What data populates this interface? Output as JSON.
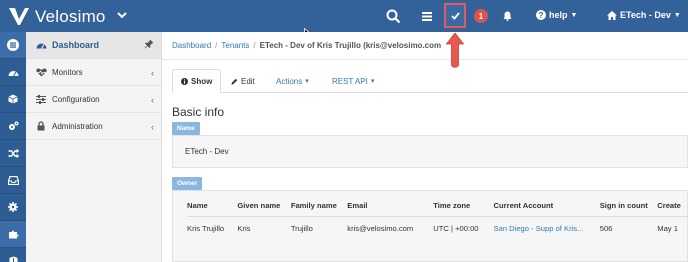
{
  "topbar": {
    "brand": "Velosimo",
    "help_label": "help",
    "tenant_label": "ETech - Dev",
    "notification_count": "1",
    "icons": [
      "search-icon",
      "list-icon",
      "check-icon",
      "bell-icon",
      "question-icon",
      "home-icon"
    ]
  },
  "sidebar": {
    "items": [
      {
        "label": "Dashboard",
        "icon": "dashboard-icon"
      },
      {
        "label": "Monitors",
        "icon": "heartbeat-icon"
      },
      {
        "label": "Configuration",
        "icon": "sliders-icon"
      },
      {
        "label": "Administration",
        "icon": "lock-icon"
      }
    ]
  },
  "breadcrumb": {
    "items": [
      "Dashboard",
      "Tenants"
    ],
    "current": "ETech - Dev of Kris Trujillo (kris@velosimo.com"
  },
  "tabs": {
    "show": "Show",
    "edit": "Edit",
    "actions": "Actions",
    "rest_api": "REST API"
  },
  "basic_info": {
    "title": "Basic info",
    "name_tag": "Name",
    "name_value": "ETech - Dev",
    "owner_tag": "Owner"
  },
  "owner_table": {
    "headers": [
      "Name",
      "Given name",
      "Family name",
      "Email",
      "Time zone",
      "Current Account",
      "Sign in count",
      "Create"
    ],
    "row": [
      "Kris Trujillo",
      "Kris",
      "Trujillo",
      "kris@velosimo.com",
      "UTC | +00:00",
      "San Diego - Supp of Kris...",
      "506",
      "May 1"
    ]
  },
  "colors": {
    "topbar": "#336199",
    "rail": "#2e5d93",
    "link": "#337ab7",
    "tag": "#8ab7e0",
    "highlight": "#e45a5a"
  }
}
